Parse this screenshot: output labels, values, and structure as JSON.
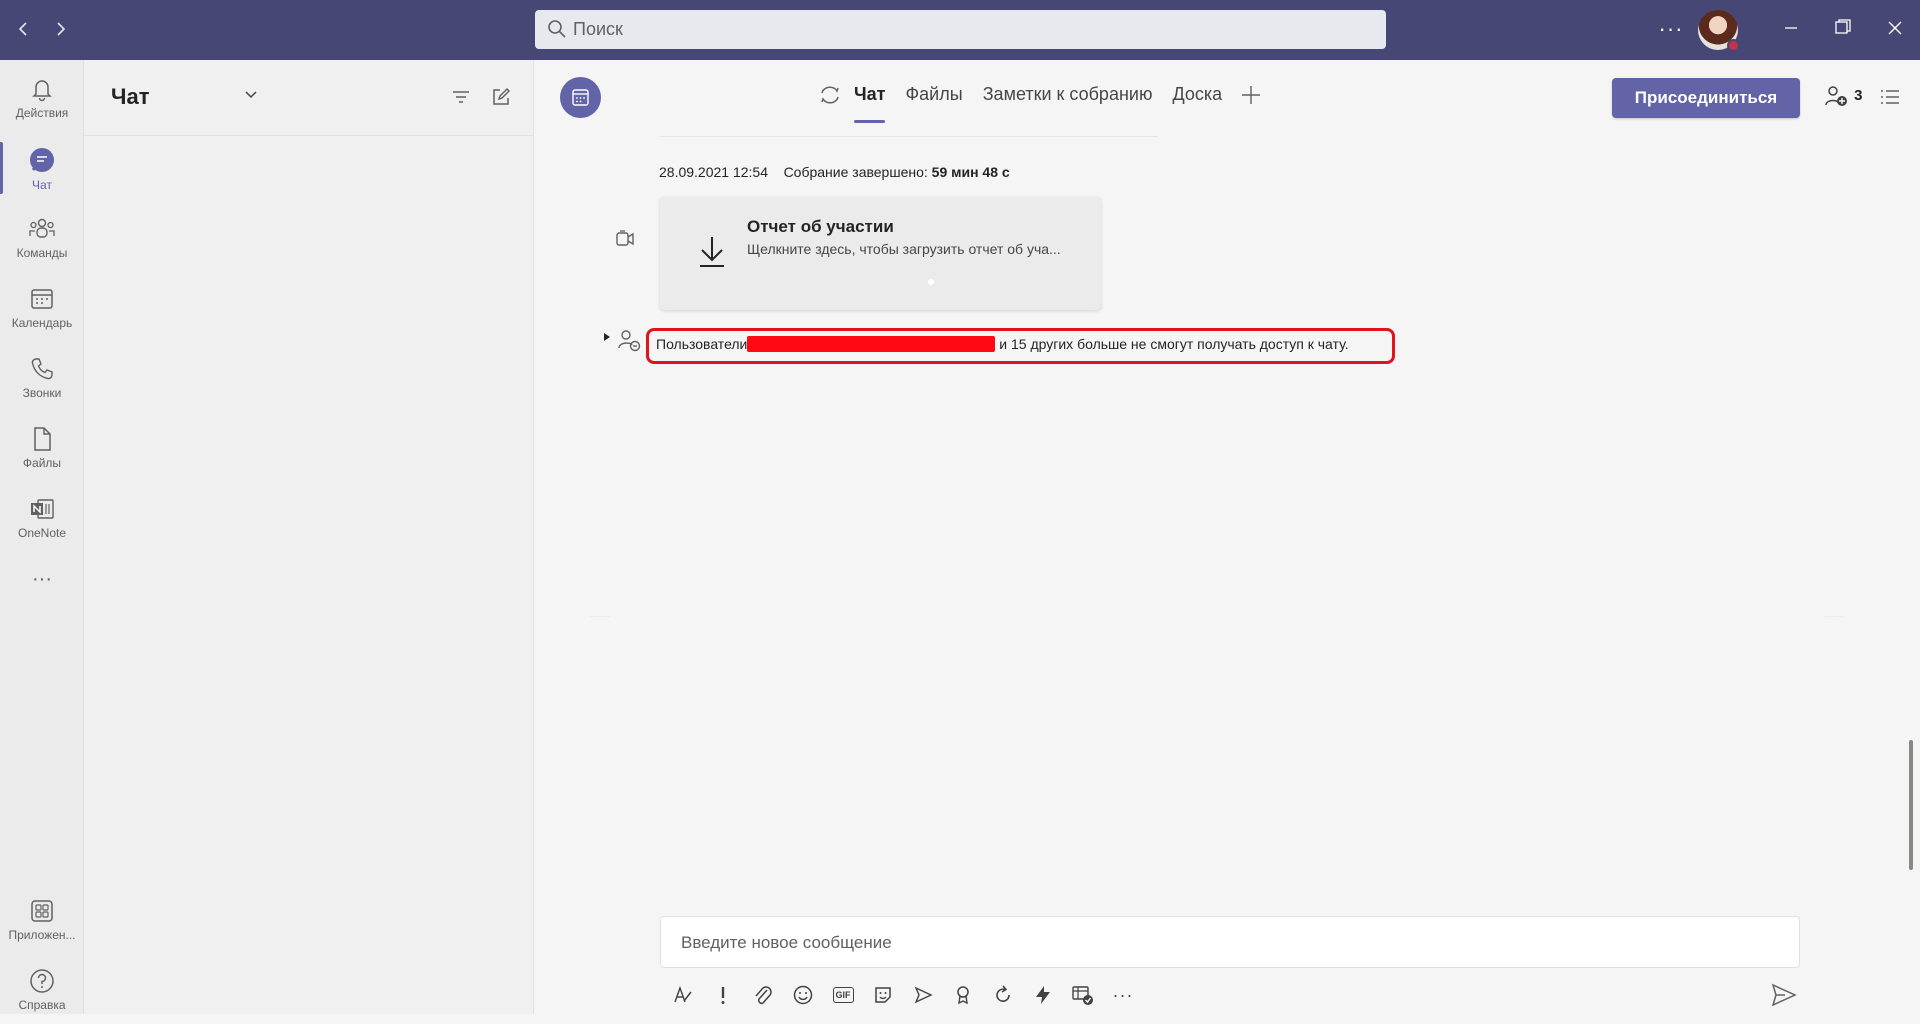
{
  "titlebar": {
    "search_placeholder": "Поиск",
    "more": "···"
  },
  "rail": {
    "items": [
      {
        "label": "Действия"
      },
      {
        "label": "Чат"
      },
      {
        "label": "Команды"
      },
      {
        "label": "Календарь"
      },
      {
        "label": "Звонки"
      },
      {
        "label": "Файлы"
      },
      {
        "label": "OneNote"
      },
      {
        "label": "···"
      },
      {
        "label": "Приложен..."
      },
      {
        "label": "Справка"
      }
    ]
  },
  "chat_list": {
    "title": "Чат"
  },
  "meeting": {
    "tabs": [
      "Чат",
      "Файлы",
      "Заметки к собранию",
      "Доска"
    ],
    "join_label": "Присоединиться",
    "participants_count": "3"
  },
  "messages": {
    "meta_date": "28.09.2021 12:54",
    "meta_label": "Собрание завершено:",
    "meta_duration": "59 мин 48 с",
    "card_title": "Отчет об участии",
    "card_subtitle": "Щелкните здесь, чтобы загрузить отчет об уча...",
    "system_prefix": "Пользователи",
    "system_suffix": " и 15 других больше не смогут получать доступ к чату."
  },
  "compose": {
    "placeholder": "Введите новое сообщение",
    "gif_label": "GIF",
    "more": "···"
  },
  "colors": {
    "brand": "#6264a7",
    "titlebar": "#464775",
    "highlight": "#e0121f"
  }
}
